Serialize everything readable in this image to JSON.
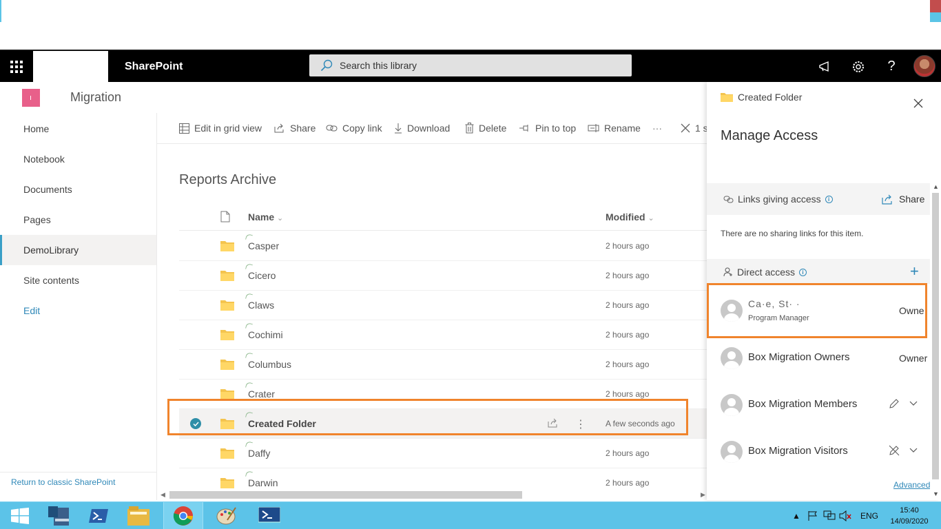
{
  "suite": {
    "brand": "SharePoint",
    "search_placeholder": "Search this library"
  },
  "site": {
    "title": "Migration"
  },
  "nav": {
    "items": [
      {
        "label": "Home"
      },
      {
        "label": "Notebook"
      },
      {
        "label": "Documents"
      },
      {
        "label": "Pages"
      },
      {
        "label": "DemoLibrary",
        "active": true
      },
      {
        "label": "Site contents"
      },
      {
        "label": "Edit"
      }
    ],
    "return_classic": "Return to classic SharePoint"
  },
  "commands": {
    "edit_grid": "Edit in grid view",
    "share": "Share",
    "copy_link": "Copy link",
    "download": "Download",
    "delete": "Delete",
    "pin": "Pin to top",
    "rename": "Rename",
    "more": "···",
    "selected": "1 s"
  },
  "library": {
    "title": "Reports Archive",
    "col_name": "Name",
    "col_modified": "Modified",
    "rows": [
      {
        "name": "Casper",
        "modified": "2 hours ago"
      },
      {
        "name": "Cicero",
        "modified": "2 hours ago"
      },
      {
        "name": "Claws",
        "modified": "2 hours ago"
      },
      {
        "name": "Cochimi",
        "modified": "2 hours ago"
      },
      {
        "name": "Columbus",
        "modified": "2 hours ago"
      },
      {
        "name": "Crater",
        "modified": "2 hours ago"
      },
      {
        "name": "Created Folder",
        "modified": "A few seconds ago",
        "selected": true
      },
      {
        "name": "Daffy",
        "modified": "2 hours ago"
      },
      {
        "name": "Darwin",
        "modified": "2 hours ago"
      }
    ]
  },
  "panel": {
    "folder_name": "Created Folder",
    "title": "Manage Access",
    "links_label": "Links giving access",
    "share_label": "Share",
    "no_links": "There are no sharing links for this item.",
    "direct_label": "Direct access",
    "people": [
      {
        "name": "Ca·e, St· ·",
        "subtitle": "Program Manager",
        "role": "Owne"
      },
      {
        "name": "Box Migration Owners",
        "role": "Owner"
      },
      {
        "name": "Box Migration Members",
        "permission_icon": "edit-icon"
      },
      {
        "name": "Box Migration Visitors",
        "permission_icon": "no-edit-icon"
      }
    ],
    "advanced": "Advanced"
  },
  "taskbar": {
    "lang": "ENG",
    "time": "15:40",
    "date": "14/09/2020"
  },
  "colors": {
    "accent": "#2f88b8",
    "highlight": "#f0842c",
    "taskbar": "#5cc3e8",
    "site_logo": "#e8608a"
  }
}
